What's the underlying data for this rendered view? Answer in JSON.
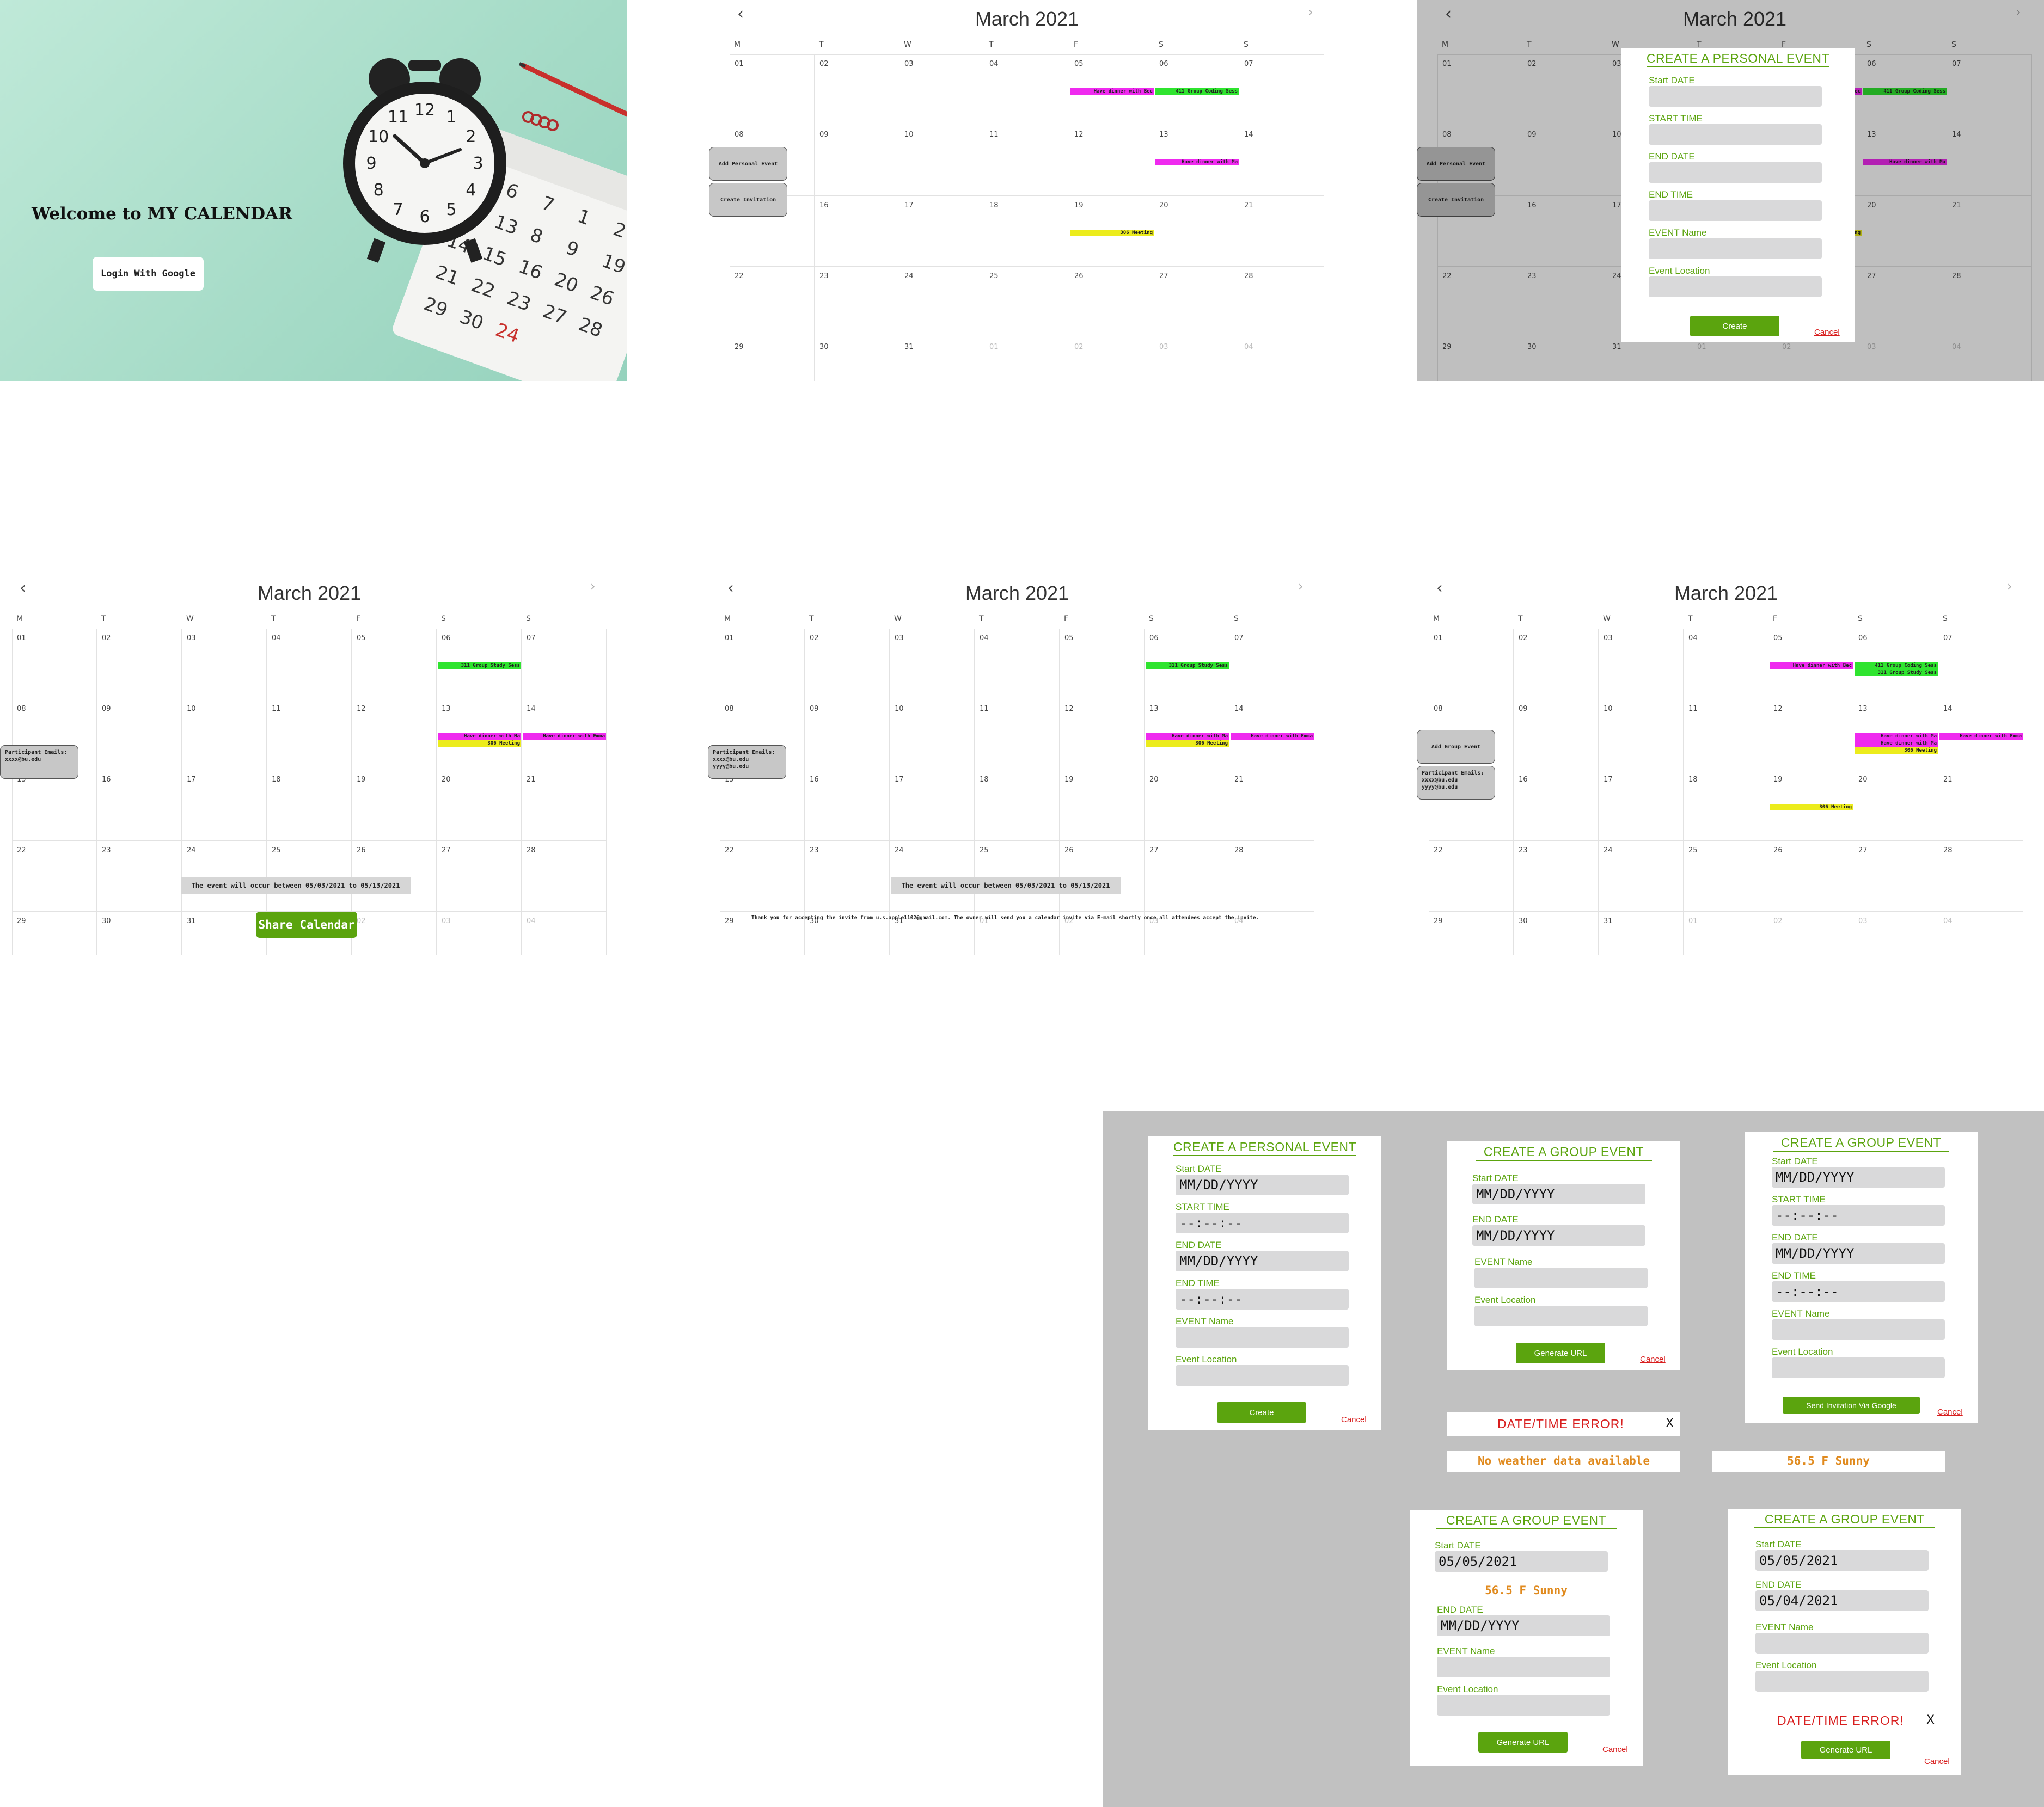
{
  "welcome": {
    "title": "Welcome to MY CALENDAR",
    "login_label": "Login With Google",
    "clock_numbers": [
      "12",
      "1",
      "2",
      "3",
      "4",
      "5",
      "6",
      "7",
      "8",
      "9",
      "10",
      "11"
    ],
    "calendar_numbers": [
      "5",
      "6",
      "7",
      "1",
      "2",
      "12",
      "13",
      "8",
      "9",
      "19",
      "14",
      "15",
      "16",
      "20",
      "26",
      "21",
      "22",
      "23",
      "27",
      "28",
      "29",
      "30",
      "24"
    ]
  },
  "calendar": {
    "month_title": "March 2021",
    "prev_icon": "chevron-left-icon",
    "next_icon": "chevron-right-icon",
    "weekdays": [
      "M",
      "T",
      "W",
      "T",
      "F",
      "S",
      "S"
    ],
    "days": [
      "01",
      "02",
      "03",
      "04",
      "05",
      "06",
      "07",
      "08",
      "09",
      "10",
      "11",
      "12",
      "13",
      "14",
      "15",
      "16",
      "17",
      "18",
      "19",
      "20",
      "21",
      "22",
      "23",
      "24",
      "25",
      "26",
      "27",
      "28",
      "29",
      "30",
      "31",
      "01",
      "02",
      "03",
      "04"
    ],
    "colors": {
      "magenta": "#ef2aef",
      "green": "#2fe42f",
      "yellow": "#ecec1c",
      "accent_green": "#5ba40e",
      "error_red": "#d81e1e",
      "weather_orange": "#e08a1e"
    }
  },
  "panel2": {
    "add_personal_event": "Add Personal Event",
    "create_invitation": "Create Invitation",
    "events": [
      {
        "day": 5,
        "label": "Have dinner with Bec",
        "color": "magenta"
      },
      {
        "day": 6,
        "label": "411 Group Coding Sess",
        "color": "green"
      },
      {
        "day": 13,
        "label": "Have dinner with Ma",
        "color": "magenta"
      },
      {
        "day": 19,
        "label": "306 Meeting",
        "color": "yellow"
      }
    ]
  },
  "panel3": {
    "add_personal_event": "Add Personal Event",
    "create_invitation": "Create Invitation",
    "events": [
      {
        "day": 5,
        "label": "Have dinner with Bec",
        "color": "magenta"
      },
      {
        "day": 6,
        "label": "411 Group Coding Sess",
        "color": "green"
      },
      {
        "day": 13,
        "label": "Have dinner with Ma",
        "color": "magenta"
      },
      {
        "day": 19,
        "label": "306 Meeting",
        "color": "yellow"
      }
    ],
    "form": {
      "title": "CREATE A PERSONAL EVENT",
      "start_date_label": "Start DATE",
      "start_time_label": "START TIME",
      "end_date_label": "END DATE",
      "end_time_label": "END TIME",
      "event_name_label": "EVENT Name",
      "event_location_label": "Event Location",
      "create_label": "Create",
      "cancel_label": "Cancel"
    }
  },
  "panel4": {
    "participant_label": "Participant Emails:",
    "participants": [
      "xxxx@bu.edu"
    ],
    "events": [
      {
        "day": 6,
        "label": "311 Group Study Sess",
        "color": "green"
      },
      {
        "day": 13,
        "label": "Have dinner with Ma",
        "color": "magenta"
      },
      {
        "day": 13,
        "label": "306 Meeting",
        "color": "yellow",
        "row": 2
      },
      {
        "day": 14,
        "label": "Have dinner with Emma",
        "color": "magenta"
      }
    ],
    "range_text": "The event will occur between 05/03/2021 to 05/13/2021",
    "share_label": "Share Calendar"
  },
  "panel5": {
    "participant_label": "Participant Emails:",
    "participants": [
      "xxxx@bu.edu",
      "yyyy@bu.edu"
    ],
    "events": [
      {
        "day": 6,
        "label": "311 Group Study Sess",
        "color": "green"
      },
      {
        "day": 13,
        "label": "Have dinner with Ma",
        "color": "magenta"
      },
      {
        "day": 13,
        "label": "306 Meeting",
        "color": "yellow",
        "row": 2
      },
      {
        "day": 14,
        "label": "Have dinner with Emma",
        "color": "magenta"
      }
    ],
    "range_text": "The event will occur between 05/03/2021 to 05/13/2021",
    "thanks_text": "Thank you for accepting the invite from u.s.apple1102@gmail.com. The owner will send you a calendar invite via E-mail shortly once all attendees accept the invite."
  },
  "panel6": {
    "add_group_event": "Add Group Event",
    "participant_label": "Participant Emails:",
    "participants": [
      "xxxx@bu.edu",
      "yyyy@bu.edu"
    ],
    "events": [
      {
        "day": 5,
        "label": "Have dinner with Bec",
        "color": "magenta"
      },
      {
        "day": 6,
        "label": "411 Group Coding Sess",
        "color": "green"
      },
      {
        "day": 6,
        "label": "311 Group Study Sess",
        "color": "green",
        "row": 2
      },
      {
        "day": 13,
        "label": "Have dinner with Ma",
        "color": "magenta"
      },
      {
        "day": 13,
        "label": "Have dinner with Ma",
        "color": "magenta",
        "row": 2
      },
      {
        "day": 13,
        "label": "306 Meeting",
        "color": "yellow",
        "row": 3
      },
      {
        "day": 14,
        "label": "Have dinner with Emma",
        "color": "magenta"
      },
      {
        "day": 19,
        "label": "306 Meeting",
        "color": "yellow"
      }
    ]
  },
  "forms": {
    "personal": {
      "title": "CREATE A PERSONAL EVENT",
      "start_date_label": "Start DATE",
      "start_date_value": "MM/DD/YYYY",
      "start_time_label": "START TIME",
      "start_time_value": "--:--:--",
      "end_date_label": "END DATE",
      "end_date_value": "MM/DD/YYYY",
      "end_time_label": "END TIME",
      "end_time_value": "--:--:--",
      "event_name_label": "EVENT Name",
      "event_location_label": "Event Location",
      "create_label": "Create",
      "cancel_label": "Cancel"
    },
    "group1": {
      "title": "CREATE A GROUP EVENT",
      "start_date_label": "Start DATE",
      "start_date_value": "MM/DD/YYYY",
      "end_date_label": "END DATE",
      "end_date_value": "MM/DD/YYYY",
      "event_name_label": "EVENT Name",
      "event_location_label": "Event Location",
      "generate_label": "Generate URL",
      "cancel_label": "Cancel"
    },
    "group2": {
      "title": "CREATE A GROUP EVENT",
      "start_date_label": "Start DATE",
      "start_date_value": "MM/DD/YYYY",
      "start_time_label": "START TIME",
      "start_time_value": "--:--:--",
      "end_date_label": "END DATE",
      "end_date_value": "MM/DD/YYYY",
      "end_time_label": "END TIME",
      "end_time_value": "--:--:--",
      "event_name_label": "EVENT Name",
      "event_location_label": "Event Location",
      "send_label": "Send Invitation Via Google",
      "cancel_label": "Cancel"
    },
    "error1": {
      "text": "DATE/TIME ERROR!",
      "close": "X"
    },
    "weather1": "No weather data available",
    "weather2": "56.5 F Sunny",
    "group3": {
      "title": "CREATE A GROUP EVENT",
      "start_date_label": "Start DATE",
      "start_date_value": "05/05/2021",
      "weather": "56.5 F Sunny",
      "end_date_label": "END DATE",
      "end_date_value": "MM/DD/YYYY",
      "event_name_label": "EVENT Name",
      "event_location_label": "Event Location",
      "generate_label": "Generate URL",
      "cancel_label": "Cancel"
    },
    "group4": {
      "title": "CREATE A GROUP EVENT",
      "start_date_label": "Start DATE",
      "start_date_value": "05/05/2021",
      "end_date_label": "END DATE",
      "end_date_value": "05/04/2021",
      "event_name_label": "EVENT Name",
      "event_location_label": "Event Location",
      "error_text": "DATE/TIME ERROR!",
      "error_close": "X",
      "generate_label": "Generate URL",
      "cancel_label": "Cancel"
    }
  }
}
